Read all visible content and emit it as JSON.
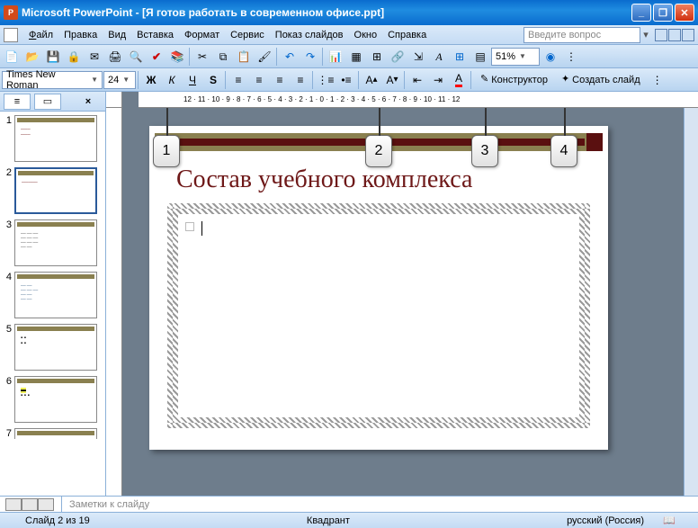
{
  "app": {
    "title": "Microsoft PowerPoint - [Я готов работать в современном офисе.ppt]"
  },
  "menu": {
    "file": "Файл",
    "edit": "Правка",
    "view": "Вид",
    "insert": "Вставка",
    "format": "Формат",
    "tools": "Сервис",
    "slideshow": "Показ слайдов",
    "window": "Окно",
    "help": "Справка",
    "help_placeholder": "Введите вопрос"
  },
  "toolbar1": {
    "zoom": "51%"
  },
  "toolbar2": {
    "font": "Times New Roman",
    "size": "24",
    "designer": "Конструктор",
    "new_slide": "Создать слайд"
  },
  "callouts": {
    "c1": "1",
    "c2": "2",
    "c3": "3",
    "c4": "4"
  },
  "slide": {
    "title": "Состав учебного комплекса"
  },
  "thumbs": {
    "n1": "1",
    "n2": "2",
    "n3": "3",
    "n4": "4",
    "n5": "5",
    "n6": "6",
    "n7": "7"
  },
  "notes": {
    "placeholder": "Заметки к слайду"
  },
  "status": {
    "slide": "Слайд 2 из 19",
    "design": "Квадрант",
    "lang": "русский (Россия)"
  },
  "ruler": {
    "marks": "12 · 11 · 10 · 9 · 8 · 7 · 6 · 5 · 4 · 3 · 2 · 1 · 0 · 1 · 2 · 3 · 4 · 5 · 6 · 7 · 8 · 9 · 10 · 11 · 12"
  }
}
